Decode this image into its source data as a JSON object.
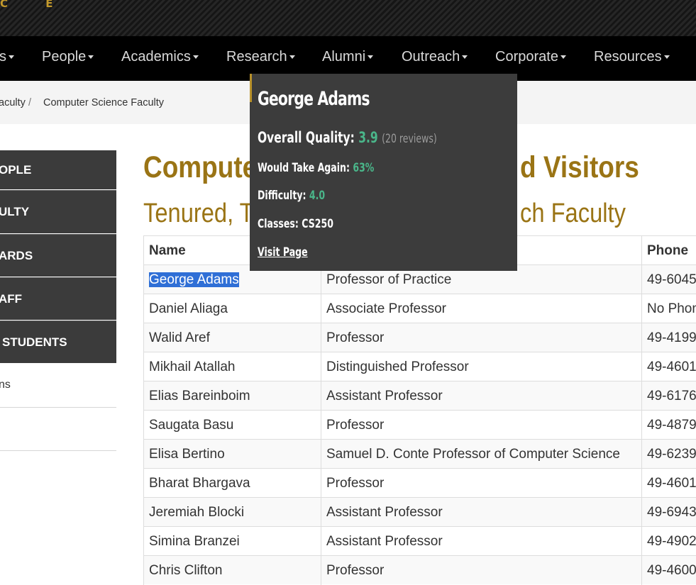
{
  "banner": {
    "text": "C E"
  },
  "nav": {
    "items": [
      {
        "label": "s"
      },
      {
        "label": "People"
      },
      {
        "label": "Academics"
      },
      {
        "label": "Research"
      },
      {
        "label": "Alumni"
      },
      {
        "label": "Outreach"
      },
      {
        "label": "Corporate"
      },
      {
        "label": "Resources"
      }
    ]
  },
  "breadcrumb": {
    "items": [
      {
        "label": "aculty"
      },
      {
        "label": "Computer Science Faculty"
      }
    ],
    "separator": "/"
  },
  "sidebar": {
    "dark_items": [
      {
        "label": "OPLE"
      },
      {
        "label": "ULTY"
      },
      {
        "label": "ARDS"
      },
      {
        "label": "AFF"
      },
      {
        "label": "STUDENTS"
      }
    ],
    "light_items": [
      {
        "label": "ns"
      },
      {
        "label": ""
      }
    ]
  },
  "heading": {
    "title_left": "Compute",
    "title_right": "d Visitors",
    "subtitle_left": "Tenured, T",
    "subtitle_right": "ch Faculty"
  },
  "table": {
    "headers": {
      "name": "Name",
      "title": "",
      "phone": "Phone"
    },
    "rows": [
      {
        "name": "George Adams",
        "title": "Professor of Practice",
        "phone": "49-6045"
      },
      {
        "name": "Daniel Aliaga",
        "title": "Associate Professor",
        "phone": "No Phon"
      },
      {
        "name": "Walid Aref",
        "title": "Professor",
        "phone": "49-4199"
      },
      {
        "name": "Mikhail Atallah",
        "title": "Distinguished Professor",
        "phone": "49-4601"
      },
      {
        "name": "Elias Bareinboim",
        "title": "Assistant Professor",
        "phone": "49-6176"
      },
      {
        "name": "Saugata Basu",
        "title": "Professor",
        "phone": "49-4879"
      },
      {
        "name": "Elisa Bertino",
        "title": "Samuel D. Conte Professor of Computer Science",
        "phone": "49-6239"
      },
      {
        "name": "Bharat Bhargava",
        "title": "Professor",
        "phone": "49-4601"
      },
      {
        "name": "Jeremiah Blocki",
        "title": "Assistant Professor",
        "phone": "49-6943"
      },
      {
        "name": "Simina Branzei",
        "title": "Assistant Professor",
        "phone": "49-4902"
      },
      {
        "name": "Chris Clifton",
        "title": "Professor",
        "phone": "49-4600"
      }
    ]
  },
  "popup": {
    "name": "George Adams",
    "overall_label": "Overall Quality:",
    "overall_value": "3.9",
    "reviews": "(20 reviews)",
    "take_again_label": "Would Take Again:",
    "take_again_value": "63%",
    "difficulty_label": "Difficulty:",
    "difficulty_value": "4.0",
    "classes_label": "Classes:",
    "classes_value": "CS250",
    "link": "Visit Page"
  },
  "colors": {
    "gold": "#9a7415",
    "rating_green": "#4ab68a",
    "selection_blue": "#2f6fd6"
  }
}
